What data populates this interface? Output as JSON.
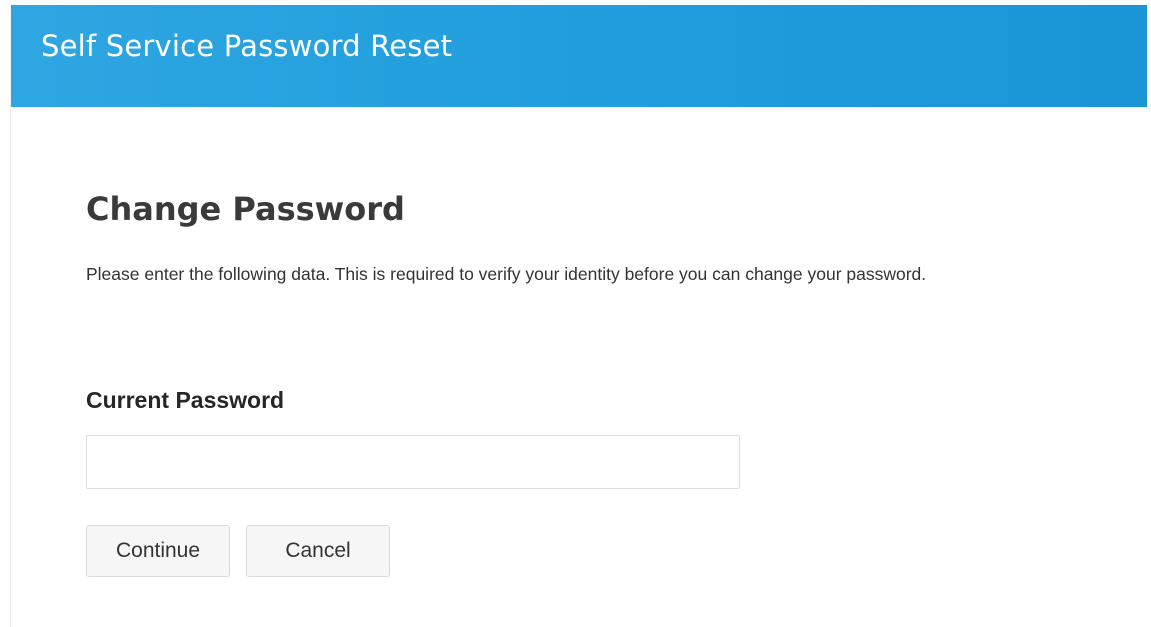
{
  "header": {
    "title": "Self Service Password Reset"
  },
  "main": {
    "title": "Change Password",
    "intro": "Please enter the following data. This is required to verify your identity before you can change your password."
  },
  "form": {
    "current_password_label": "Current Password",
    "current_password_value": "",
    "current_password_placeholder": ""
  },
  "buttons": {
    "continue_label": "Continue",
    "cancel_label": "Cancel"
  },
  "colors": {
    "header_bg": "#1f9ddc",
    "header_text": "#ffffff",
    "button_bg": "#f6f6f6"
  }
}
